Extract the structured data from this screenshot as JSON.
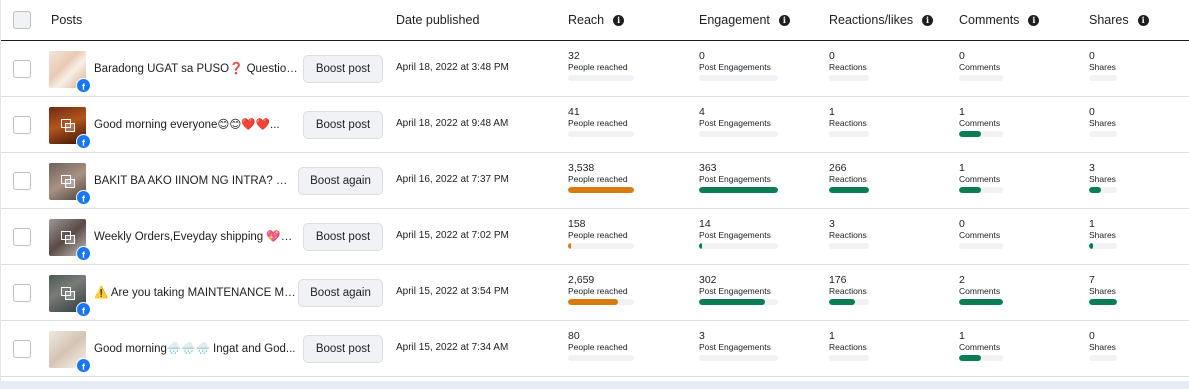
{
  "header": {
    "posts": "Posts",
    "date_published": "Date published",
    "reach": "Reach",
    "engagement": "Engagement",
    "reactions": "Reactions/likes",
    "comments": "Comments",
    "shares": "Shares",
    "info_glyph": "i"
  },
  "colors": {
    "reach_bar": "#d97b0e",
    "green_bar": "#0a7d52",
    "bar_track": "#f0f2f5",
    "facebook_blue": "#1877f2"
  },
  "rows": [
    {
      "title": "Baradong UGAT sa PUSO❓ Question a...",
      "button": "Boost post",
      "date": "April 18, 2022 at 3:48 PM",
      "reach": {
        "value": "32",
        "label": "People reached",
        "fill": 0.0
      },
      "engagement": {
        "value": "0",
        "label": "Post Engagements",
        "fill": 0.0
      },
      "reactions": {
        "value": "0",
        "label": "Reactions",
        "fill": 0.0
      },
      "comments": {
        "value": "0",
        "label": "Comments",
        "fill": 0.0
      },
      "shares": {
        "value": "0",
        "label": "Shares",
        "fill": 0.0
      }
    },
    {
      "title": "Good morning everyone😊😊❤️❤️...",
      "button": "Boost post",
      "date": "April 18, 2022 at 9:48 AM",
      "reach": {
        "value": "41",
        "label": "People reached",
        "fill": 0.0
      },
      "engagement": {
        "value": "4",
        "label": "Post Engagements",
        "fill": 0.0
      },
      "reactions": {
        "value": "1",
        "label": "Reactions",
        "fill": 0.0
      },
      "comments": {
        "value": "1",
        "label": "Comments",
        "fill": 0.5
      },
      "shares": {
        "value": "0",
        "label": "Shares",
        "fill": 0.0
      }
    },
    {
      "title": "BAKIT BA AKO IINOM NG INTRA? 🌿...",
      "button": "Boost again",
      "date": "April 16, 2022 at 7:37 PM",
      "reach": {
        "value": "3,538",
        "label": "People reached",
        "fill": 1.0
      },
      "engagement": {
        "value": "363",
        "label": "Post Engagements",
        "fill": 1.0
      },
      "reactions": {
        "value": "266",
        "label": "Reactions",
        "fill": 1.0
      },
      "comments": {
        "value": "1",
        "label": "Comments",
        "fill": 0.5
      },
      "shares": {
        "value": "3",
        "label": "Shares",
        "fill": 0.43
      }
    },
    {
      "title": "Weekly Orders,Eveyday shipping 💖💖...",
      "button": "Boost post",
      "date": "April 15, 2022 at 7:02 PM",
      "reach": {
        "value": "158",
        "label": "People reached",
        "fill": 0.05
      },
      "engagement": {
        "value": "14",
        "label": "Post Engagements",
        "fill": 0.04
      },
      "reactions": {
        "value": "3",
        "label": "Reactions",
        "fill": 0.0
      },
      "comments": {
        "value": "0",
        "label": "Comments",
        "fill": 0.0
      },
      "shares": {
        "value": "1",
        "label": "Shares",
        "fill": 0.14
      }
    },
    {
      "title": "⚠️ Are you taking MAINTENANCE ME...",
      "button": "Boost again",
      "date": "April 15, 2022 at 3:54 PM",
      "reach": {
        "value": "2,659",
        "label": "People reached",
        "fill": 0.75
      },
      "engagement": {
        "value": "302",
        "label": "Post Engagements",
        "fill": 0.83
      },
      "reactions": {
        "value": "176",
        "label": "Reactions",
        "fill": 0.66
      },
      "comments": {
        "value": "2",
        "label": "Comments",
        "fill": 1.0
      },
      "shares": {
        "value": "7",
        "label": "Shares",
        "fill": 1.0
      }
    },
    {
      "title": "Good morning🌧️🌧️🌧️ Ingat and God...",
      "button": "Boost post",
      "date": "April 15, 2022 at 7:34 AM",
      "reach": {
        "value": "80",
        "label": "People reached",
        "fill": 0.0
      },
      "engagement": {
        "value": "3",
        "label": "Post Engagements",
        "fill": 0.0
      },
      "reactions": {
        "value": "1",
        "label": "Reactions",
        "fill": 0.0
      },
      "comments": {
        "value": "1",
        "label": "Comments",
        "fill": 0.5
      },
      "shares": {
        "value": "0",
        "label": "Shares",
        "fill": 0.0
      }
    }
  ]
}
